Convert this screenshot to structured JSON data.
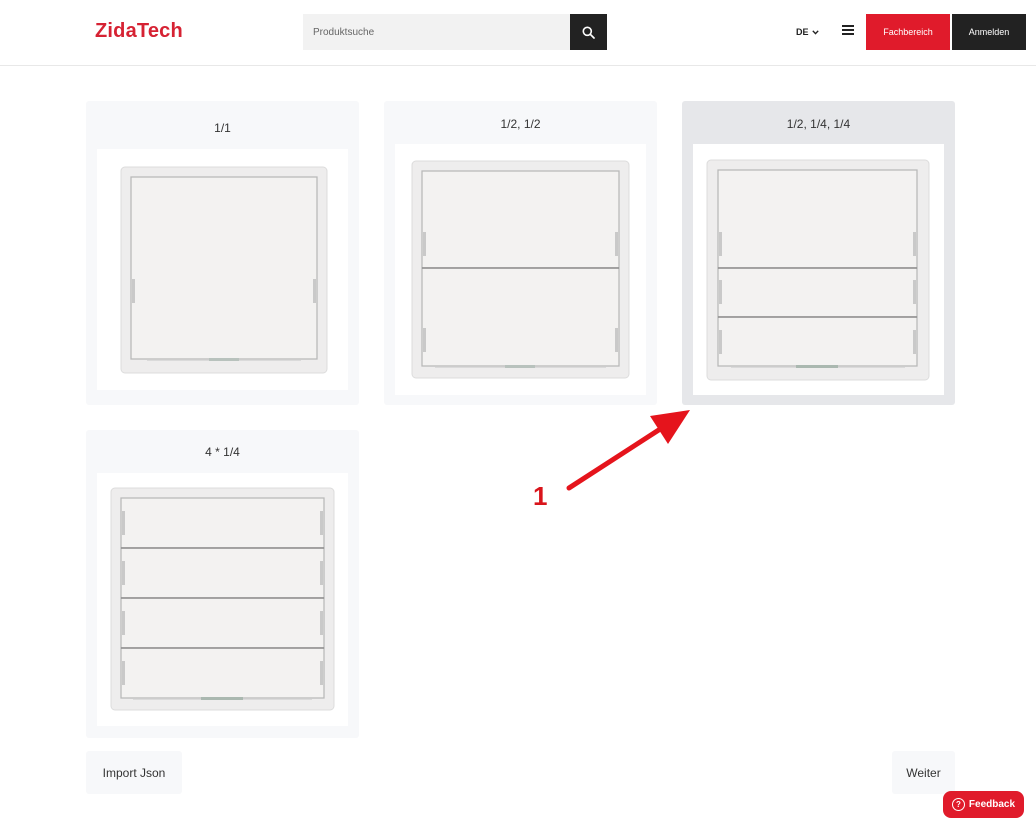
{
  "header": {
    "logo": "ZidaTech",
    "search_placeholder": "Produktsuche",
    "language": "DE",
    "fachbereich_label": "Fachbereich",
    "anmelden_label": "Anmelden"
  },
  "cards": [
    {
      "title": "1/1",
      "icon": "switch-1-rocker-icon"
    },
    {
      "title": "1/2, 1/2",
      "icon": "switch-2-rocker-icon"
    },
    {
      "title": "1/2, 1/4, 1/4",
      "icon": "switch-3-rocker-icon",
      "selected": true
    },
    {
      "title": "4 * 1/4",
      "icon": "switch-4-rocker-icon"
    }
  ],
  "footer": {
    "import_label": "Import Json",
    "next_label": "Weiter"
  },
  "annotation": {
    "label": "1",
    "color": "#d9141b"
  },
  "feedback": {
    "label": "Feedback"
  },
  "colors": {
    "brand": "#e01b2b",
    "dark": "#222222"
  }
}
